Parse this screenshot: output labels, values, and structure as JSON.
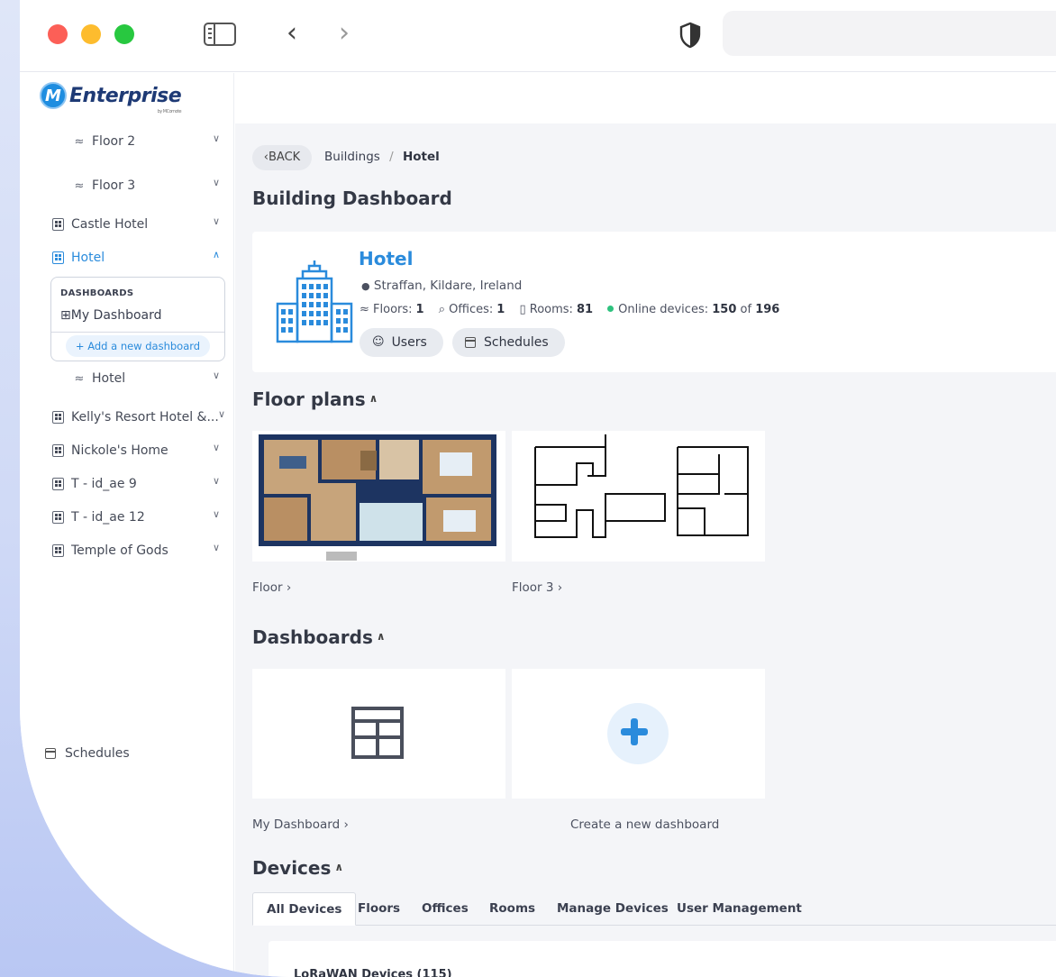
{
  "colors": {
    "accent": "#2a8bdc",
    "online": "#2ec27e",
    "dark_navy": "#1e3a75"
  },
  "browser": {
    "icons": [
      "sidebar-toggle-icon",
      "back-arrow-icon",
      "forward-arrow-icon",
      "shield-icon"
    ]
  },
  "sidebar": {
    "logo_letter": "M",
    "logo_text": "Enterprise",
    "logo_sub": "by MComote",
    "items": [
      {
        "label": "Floor 2"
      },
      {
        "label": "Floor 3"
      },
      {
        "label": "Castle Hotel"
      },
      {
        "label": "Hotel"
      },
      {
        "label": "Hotel"
      },
      {
        "label": "Kelly's Resort Hotel &..."
      },
      {
        "label": "Nickole's Home"
      },
      {
        "label": "T - id_ae 9"
      },
      {
        "label": "T - id_ae 12"
      },
      {
        "label": "Temple of Gods"
      }
    ],
    "dashboards": {
      "heading": "DASHBOARDS",
      "my_dashboard": "My Dashboard",
      "add_button": "+ Add a new dashboard"
    },
    "schedules": "Schedules"
  },
  "main": {
    "back_label": "BACK",
    "breadcrumb": {
      "parent": "Buildings",
      "sep": "/",
      "current": "Hotel"
    },
    "page_title": "Building Dashboard",
    "building": {
      "name": "Hotel",
      "location": "Straffan, Kildare, Ireland",
      "floors_label": "Floors:",
      "floors": "1",
      "offices_label": "Offices:",
      "offices": "1",
      "rooms_label": "Rooms:",
      "rooms": "81",
      "online_label": "Online devices:",
      "online": "150",
      "online_of": "of",
      "total": "196",
      "users_button": "Users",
      "schedules_button": "Schedules"
    },
    "floor_plans": {
      "title": "Floor plans",
      "items": [
        {
          "label": "Floor"
        },
        {
          "label": "Floor 3"
        }
      ]
    },
    "dashboards": {
      "title": "Dashboards",
      "items": [
        {
          "label": "My Dashboard"
        },
        {
          "label": "Create a new dashboard"
        }
      ]
    },
    "devices": {
      "title": "Devices",
      "tabs": [
        "All Devices",
        "Floors",
        "Offices",
        "Rooms",
        "Manage Devices",
        "User Management"
      ],
      "active_tab": "All Devices",
      "section_heading": "LoRaWAN Devices (115)"
    }
  }
}
